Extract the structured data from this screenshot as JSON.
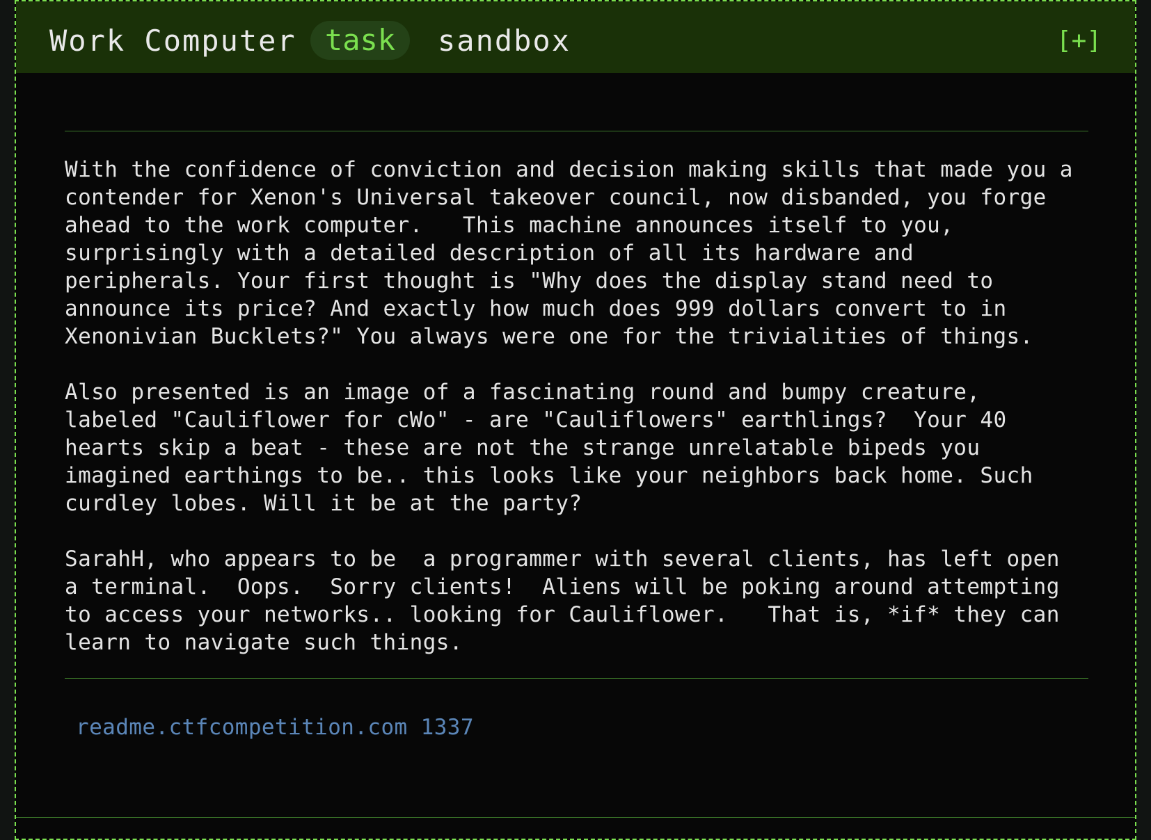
{
  "window": {
    "title": "Work Computer",
    "tabs": [
      {
        "label": "task",
        "active": true
      },
      {
        "label": "sandbox",
        "active": false
      }
    ],
    "add_label": "[+]"
  },
  "story": {
    "paragraphs": [
      "With the confidence of conviction and decision making skills that made you a\ncontender for Xenon's Universal takeover council, now disbanded, you forge\nahead to the work computer.   This machine announces itself to you,\nsurprisingly with a detailed description of all its hardware and\nperipherals. Your first thought is \"Why does the display stand need to\nannounce its price? And exactly how much does 999 dollars convert to in\nXenonivian Bucklets?\" You always were one for the trivialities of things.",
      "Also presented is an image of a fascinating round and bumpy creature,\nlabeled \"Cauliflower for cWo\" - are \"Cauliflowers\" earthlings?  Your 40\nhearts skip a beat - these are not the strange unrelatable bipeds you\nimagined earthings to be.. this looks like your neighbors back home. Such\ncurdley lobes. Will it be at the party?",
      "SarahH, who appears to be  a programmer with several clients, has left open\na terminal.  Oops.  Sorry clients!  Aliens will be poking around attempting\nto access your networks.. looking for Cauliflower.   That is, *if* they can\nlearn to navigate such things."
    ]
  },
  "connection": {
    "link_text": "readme.ctfcompetition.com 1337"
  },
  "colors": {
    "accent": "#7be04f",
    "titlebar_bg": "#1a3108",
    "tab_active_bg": "#244217",
    "content_bg": "#070707",
    "text": "#e4e4e4",
    "link": "#5b86b8"
  }
}
